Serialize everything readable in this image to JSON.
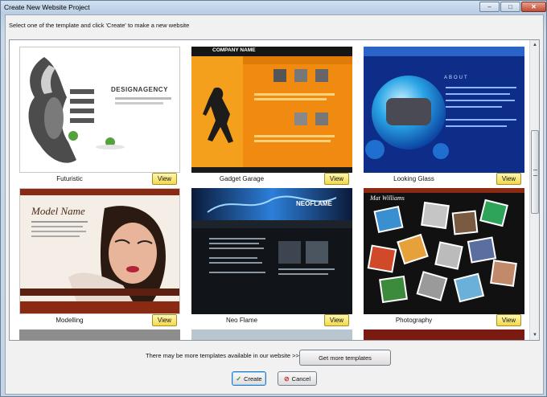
{
  "window": {
    "title": "Create New Website Project",
    "minimize": "–",
    "maximize": "□",
    "close": "✕"
  },
  "instruction": "Select one of the template and click 'Create' to make a new website",
  "templates": [
    {
      "name": "Futuristic",
      "view": "View",
      "logo": "DESIGNAGENCY"
    },
    {
      "name": "Gadget Garage",
      "view": "View",
      "logo": "COMPANY NAME"
    },
    {
      "name": "Looking Glass",
      "view": "View",
      "logo": "ABOUT"
    },
    {
      "name": "Modelling",
      "view": "View",
      "logo": "Model Name"
    },
    {
      "name": "Neo Flame",
      "view": "View",
      "logo": "NEOFLAME"
    },
    {
      "name": "Photography",
      "view": "View",
      "logo": "Mat Williams"
    }
  ],
  "footer": {
    "note": "There may be more templates available in our website >>",
    "more_button": "Get more templates",
    "create_button": "Create",
    "cancel_button": "Cancel"
  },
  "scrollbar": {
    "up": "▲",
    "down": "▼"
  }
}
